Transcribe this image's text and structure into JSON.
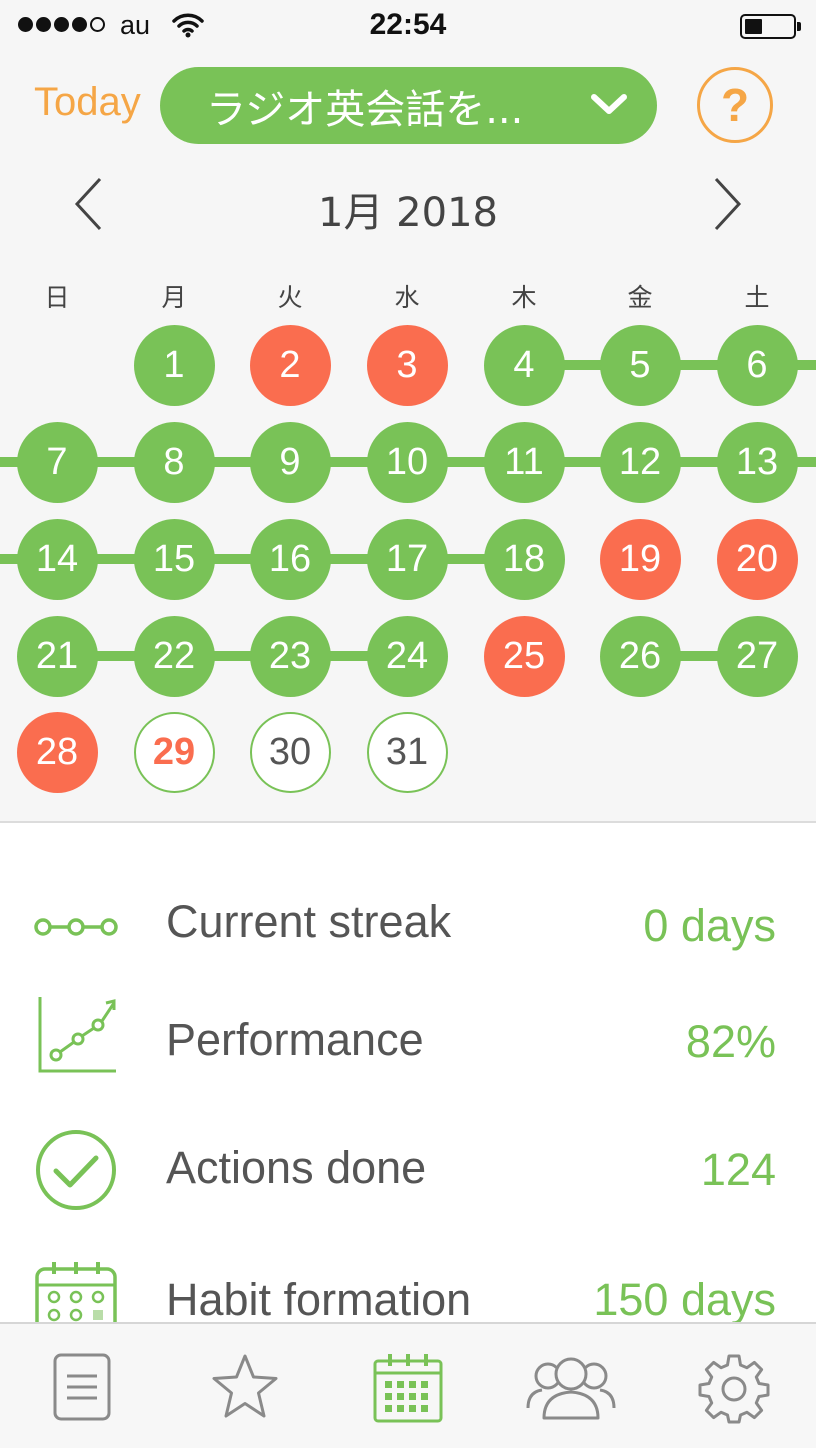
{
  "status_bar": {
    "carrier": "au",
    "time": "22:54"
  },
  "header": {
    "today_label": "Today",
    "habit_title": "ラジオ英会話を...",
    "help_label": "?"
  },
  "calendar": {
    "month_title": "1月 2018",
    "weekdays": [
      "日",
      "月",
      "火",
      "水",
      "木",
      "金",
      "土"
    ],
    "days": [
      {
        "label": "1",
        "status": "done"
      },
      {
        "label": "2",
        "status": "missed"
      },
      {
        "label": "3",
        "status": "missed"
      },
      {
        "label": "4",
        "status": "done"
      },
      {
        "label": "5",
        "status": "done"
      },
      {
        "label": "6",
        "status": "done"
      },
      {
        "label": "7",
        "status": "done"
      },
      {
        "label": "8",
        "status": "done"
      },
      {
        "label": "9",
        "status": "done"
      },
      {
        "label": "10",
        "status": "done"
      },
      {
        "label": "11",
        "status": "done"
      },
      {
        "label": "12",
        "status": "done"
      },
      {
        "label": "13",
        "status": "done"
      },
      {
        "label": "14",
        "status": "done"
      },
      {
        "label": "15",
        "status": "done"
      },
      {
        "label": "16",
        "status": "done"
      },
      {
        "label": "17",
        "status": "done"
      },
      {
        "label": "18",
        "status": "done"
      },
      {
        "label": "19",
        "status": "missed"
      },
      {
        "label": "20",
        "status": "missed"
      },
      {
        "label": "21",
        "status": "done"
      },
      {
        "label": "22",
        "status": "done"
      },
      {
        "label": "23",
        "status": "done"
      },
      {
        "label": "24",
        "status": "done"
      },
      {
        "label": "25",
        "status": "missed"
      },
      {
        "label": "26",
        "status": "done"
      },
      {
        "label": "27",
        "status": "done"
      },
      {
        "label": "28",
        "status": "missed"
      },
      {
        "label": "29",
        "status": "today"
      },
      {
        "label": "30",
        "status": "pending"
      },
      {
        "label": "31",
        "status": "pending"
      }
    ]
  },
  "stats": [
    {
      "icon": "streak-icon",
      "label": "Current streak",
      "value": "0 days"
    },
    {
      "icon": "performance-chart-icon",
      "label": "Performance",
      "value": "82%"
    },
    {
      "icon": "checkmark-circle-icon",
      "label": "Actions done",
      "value": "124"
    },
    {
      "icon": "calendar-grid-icon",
      "label": "Habit formation",
      "value": "150 days"
    }
  ],
  "tab_bar": {
    "items": [
      {
        "icon": "list-icon",
        "selected": false
      },
      {
        "icon": "star-icon",
        "selected": false
      },
      {
        "icon": "calendar-icon",
        "selected": true
      },
      {
        "icon": "community-icon",
        "selected": false
      },
      {
        "icon": "gear-icon",
        "selected": false
      }
    ]
  },
  "colors": {
    "green": "#79c257",
    "red": "#fa6d4f",
    "orange": "#f5a646"
  }
}
